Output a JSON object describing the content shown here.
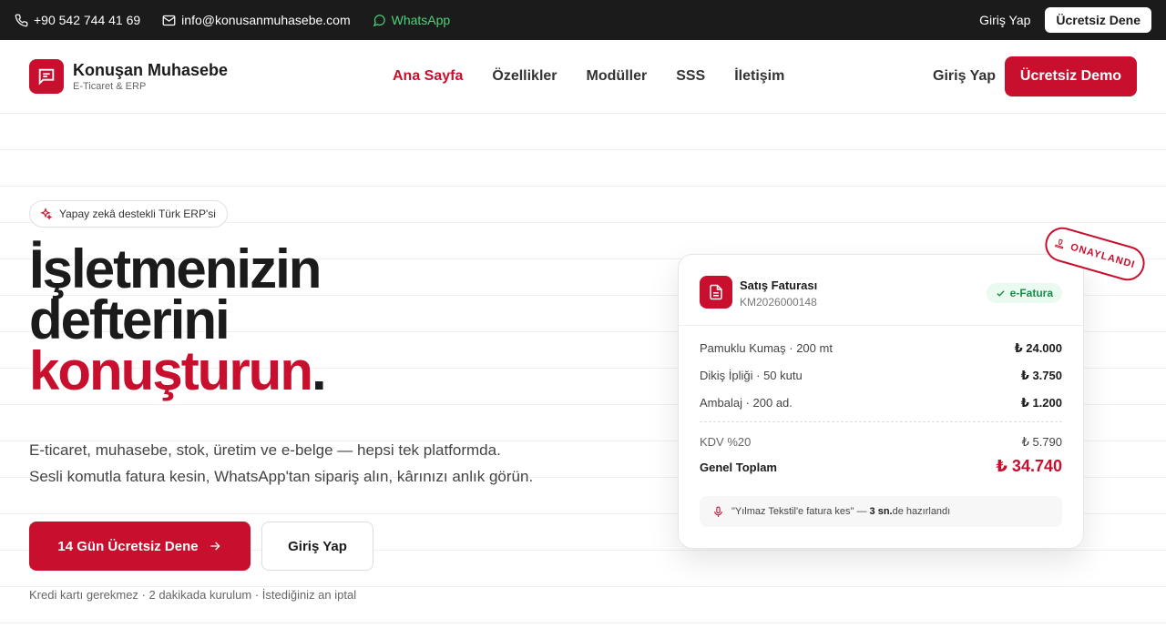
{
  "topbar": {
    "phone": "+90 542 744 41 69",
    "email": "info@konusanmuhasebe.com",
    "whatsapp": "WhatsApp",
    "login": "Giriş Yap",
    "try": "Ücretsiz Dene"
  },
  "header": {
    "brand_name": "Konuşan Muhasebe",
    "brand_sub": "E-Ticaret & ERP",
    "nav": [
      "Ana Sayfa",
      "Özellikler",
      "Modüller",
      "SSS",
      "İletişim"
    ],
    "login": "Giriş Yap",
    "demo": "Ücretsiz Demo"
  },
  "hero": {
    "pill": "Yapay zekâ destekli Türk ERP'si",
    "headline_1": "İşletmenizin",
    "headline_2": "defterini",
    "headline_3": "konuşturun",
    "headline_dot": ".",
    "desc_1": "E-ticaret, muhasebe, stok, üretim ve e-belge — hepsi tek platformda.",
    "desc_2": "Sesli komutla fatura kesin, WhatsApp'tan sipariş alın, kârınızı anlık görün.",
    "cta_primary": "14 Gün Ücretsiz Dene",
    "cta_secondary": "Giriş Yap",
    "note": "Kredi kartı gerekmez · 2 dakikada kurulum · İstediğiniz an iptal"
  },
  "invoice": {
    "title": "Satış Faturası",
    "number": "KM2026000148",
    "badge": "e-Fatura",
    "items": [
      {
        "label": "Pamuklu Kumaş · 200 mt",
        "amount": "₺ 24.000"
      },
      {
        "label": "Dikiş İpliği · 50 kutu",
        "amount": "₺ 3.750"
      },
      {
        "label": "Ambalaj · 200 ad.",
        "amount": "₺ 1.200"
      }
    ],
    "kdv_label": "KDV %20",
    "kdv_amount": "₺ 5.790",
    "total_label": "Genel Toplam",
    "total_amount": "₺ 34.740",
    "voice_quote": "\"Yılmaz Tekstil'e fatura kes\" —",
    "voice_time": "3 sn.",
    "voice_suffix": "de hazırlandı",
    "stamp": "ONAYLANDI"
  },
  "colors": {
    "brand": "#c8102e",
    "topbar": "#1b1b1b",
    "whatsapp": "#4bd37b",
    "efatura_bg": "#eafaf0",
    "efatura_text": "#1b8a4a"
  }
}
